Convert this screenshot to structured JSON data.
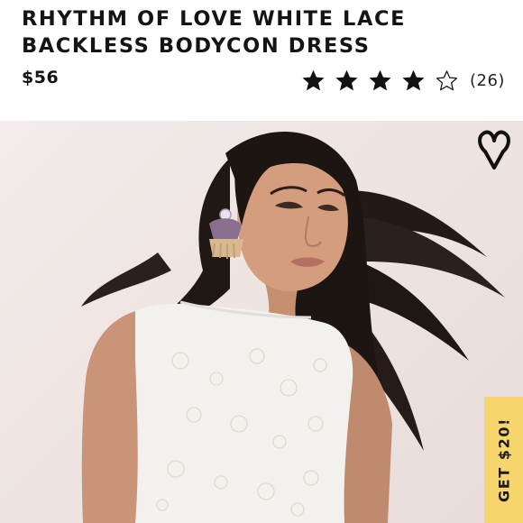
{
  "product": {
    "title": "RHYTHM OF LOVE WHITE LACE BACKLESS BODYCON DRESS",
    "price": "$56",
    "rating": {
      "stars_filled": 4,
      "stars_total": 5,
      "count_label": "(26)"
    }
  },
  "photo": {
    "alt": "Model wearing white lace dress",
    "like_icon": "heart-icon"
  },
  "promo": {
    "label": "GET $20!",
    "color": "#f6d66c"
  }
}
